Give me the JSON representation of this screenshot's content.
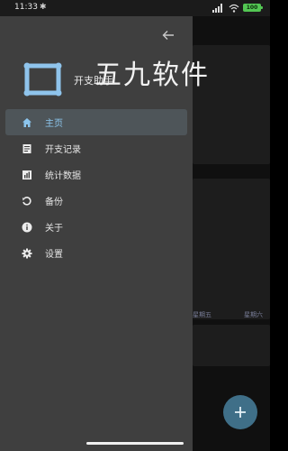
{
  "status_bar": {
    "time": "11:33",
    "bluetooth_glyph": "✱",
    "battery_level": "100"
  },
  "drawer": {
    "app_name": "开支助手",
    "menu_items": [
      {
        "label": "主页",
        "icon": "home-icon",
        "active": true
      },
      {
        "label": "开支记录",
        "icon": "receipt-icon",
        "active": false
      },
      {
        "label": "统计数据",
        "icon": "bar-chart-icon",
        "active": false
      },
      {
        "label": "备份",
        "icon": "backup-icon",
        "active": false
      },
      {
        "label": "关于",
        "icon": "info-icon",
        "active": false
      },
      {
        "label": "设置",
        "icon": "gear-icon",
        "active": false
      }
    ]
  },
  "background": {
    "weekdays": [
      "星期五",
      "星期六"
    ]
  },
  "watermark": "五九软件",
  "colors": {
    "drawer_bg": "#3f3f3f",
    "active_bg": "#4e5559",
    "accent": "#8cc6ee",
    "fab": "#3f6f88"
  }
}
